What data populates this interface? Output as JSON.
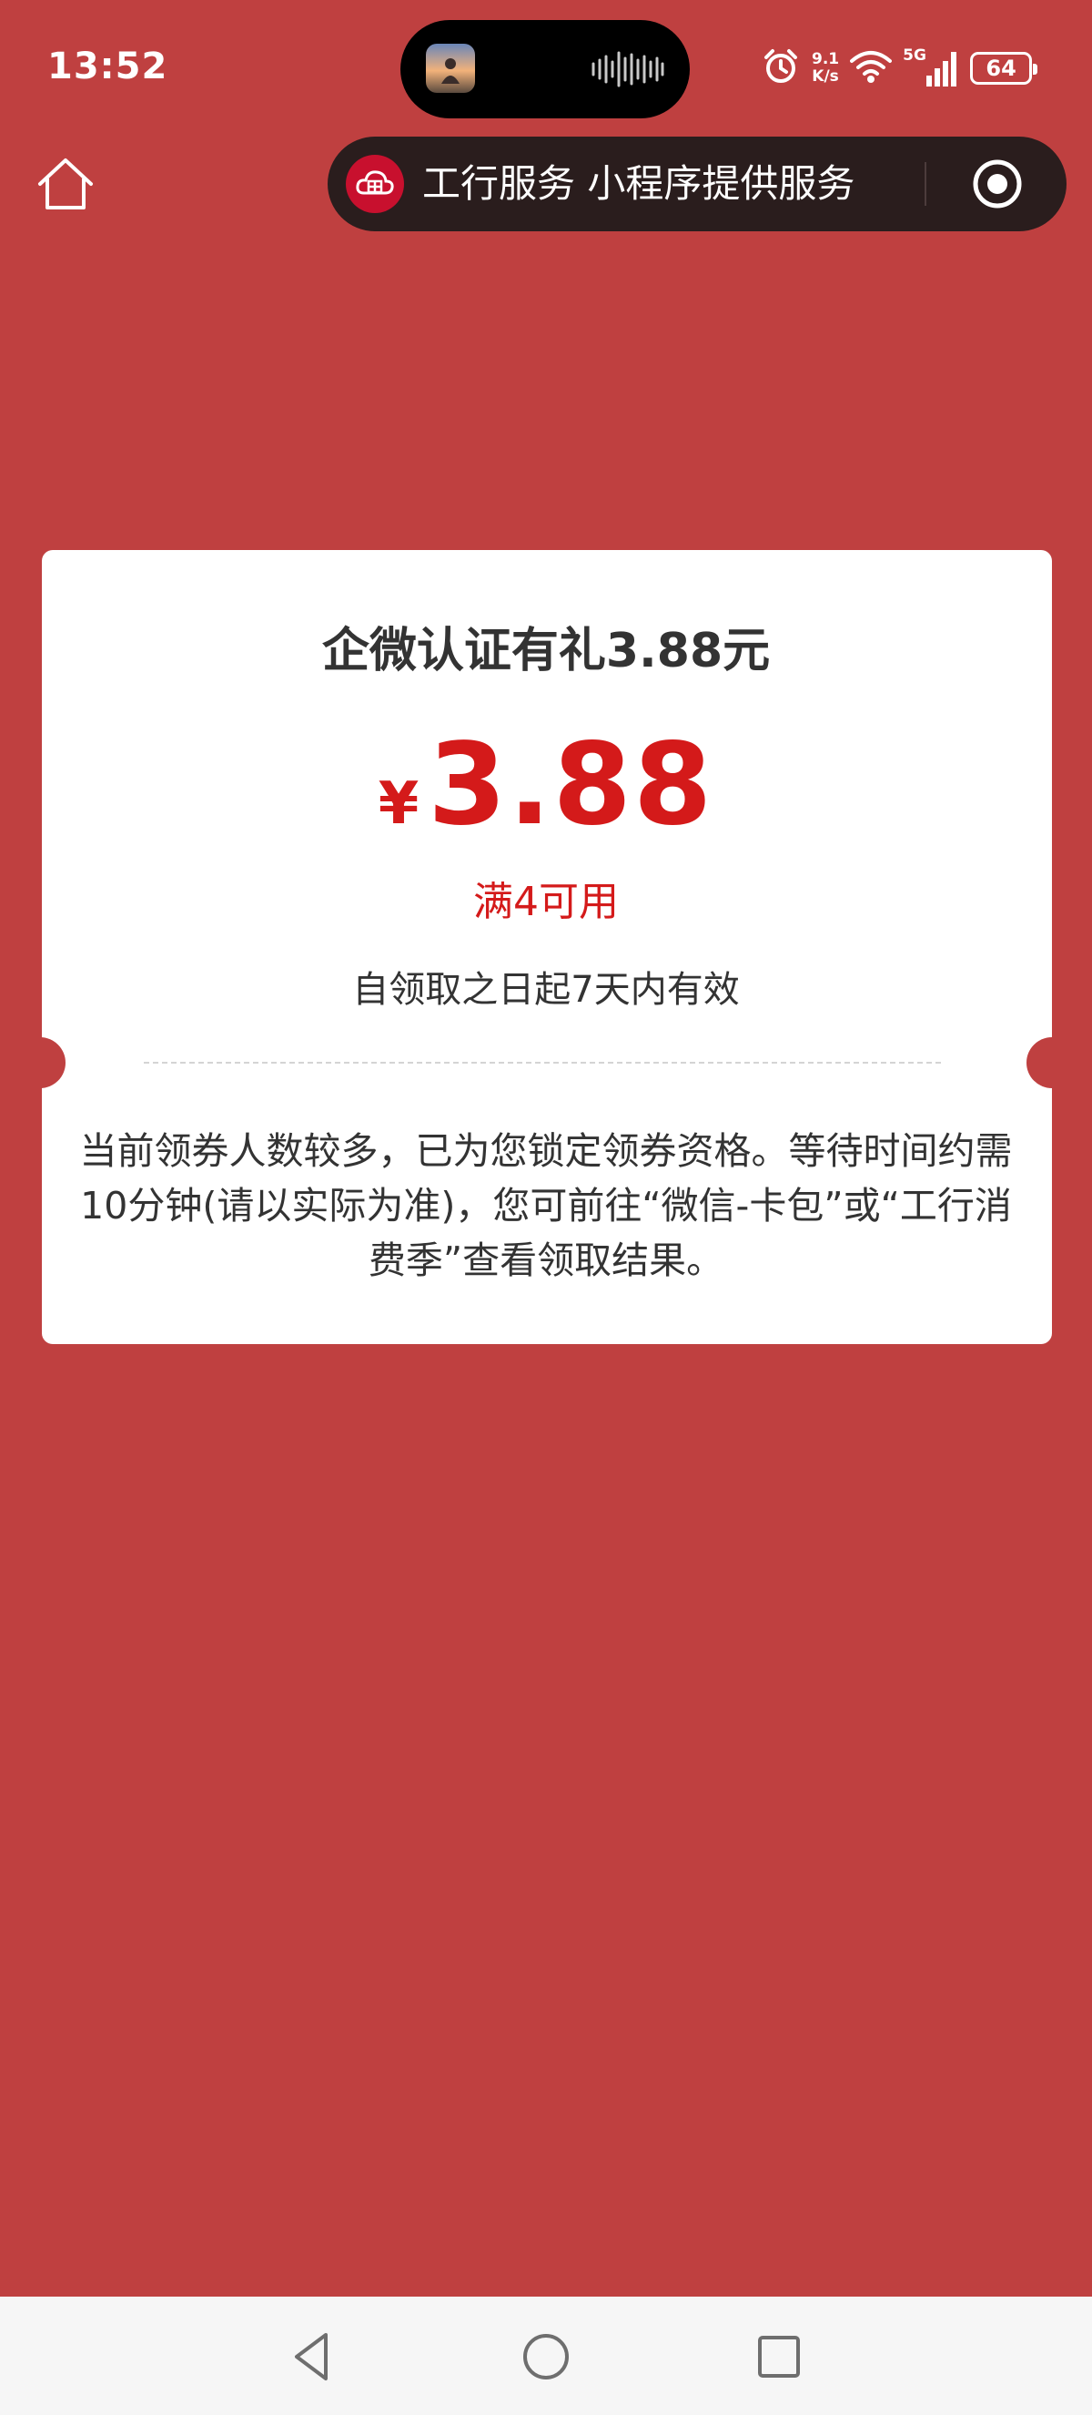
{
  "status_bar": {
    "time": "13:52",
    "net_speed_value": "9.1",
    "net_speed_unit": "K/s",
    "network_type": "5G",
    "battery": "64",
    "icons": [
      "alarm-icon",
      "wifi-icon",
      "signal-icon",
      "battery-icon"
    ]
  },
  "nav": {
    "home_icon": "home-icon",
    "capsule_text": "工行服务 小程序提供服务",
    "capsule_logo": "icbc-cloud-logo",
    "capsule_action_icon": "target-icon"
  },
  "coupon": {
    "title": "企微认证有礼3.88元",
    "currency": "¥",
    "amount": "3.88",
    "condition": "满4可用",
    "validity": "自领取之日起7天内有效",
    "notice": "当前领券人数较多，已为您锁定领券资格。等待时间约需10分钟(请以实际为准)，您可前往“微信-卡包”或“工行消费季”查看领取结果。"
  },
  "system_nav": {
    "back_icon": "back-triangle-icon",
    "home_icon": "home-circle-icon",
    "recents_icon": "recents-square-icon"
  },
  "colors": {
    "background": "#bf4040",
    "card": "#ffffff",
    "accent_red": "#d41a1a",
    "capsule": "#2a1d1d",
    "text_dark": "#333333"
  }
}
